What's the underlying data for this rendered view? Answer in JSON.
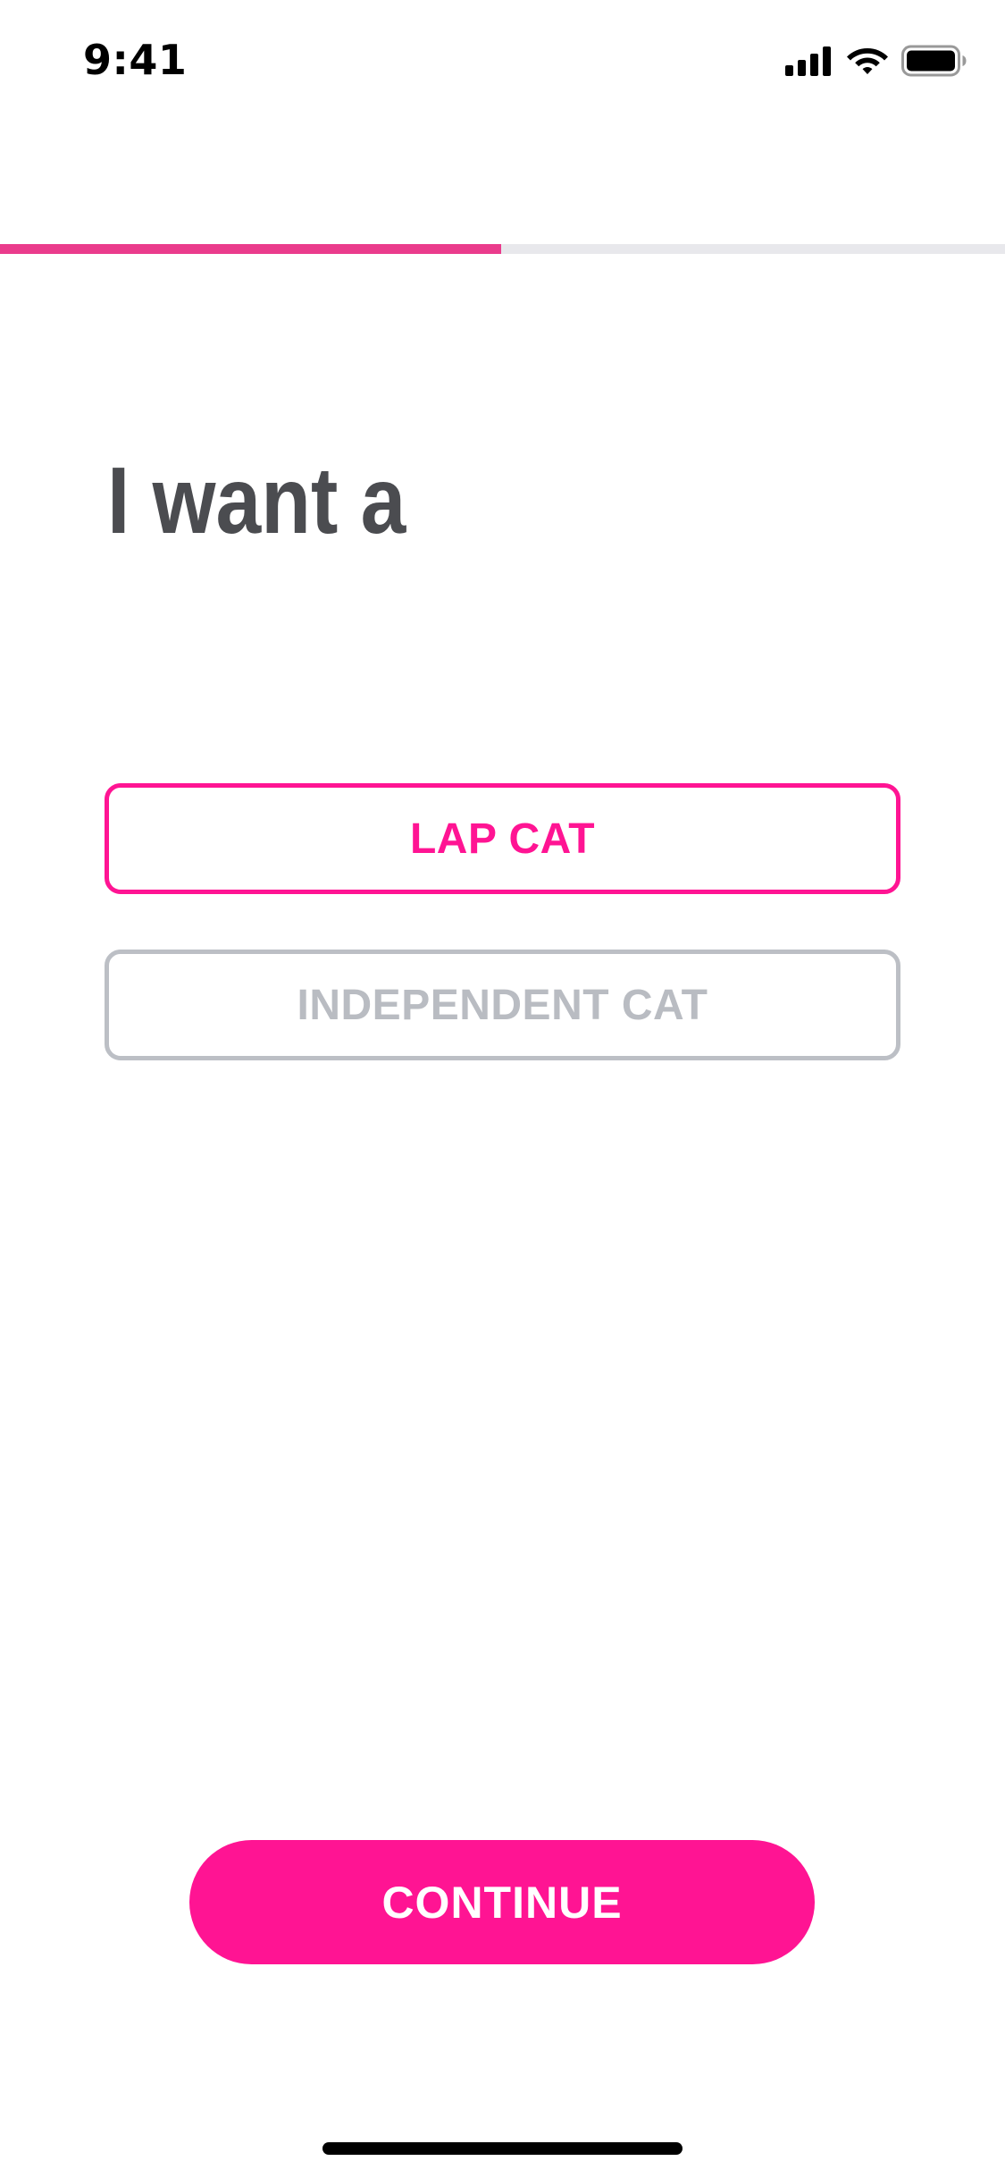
{
  "status_bar": {
    "time": "9:41",
    "icons": [
      "cellular-signal-icon",
      "wifi-icon",
      "battery-icon"
    ]
  },
  "progress": {
    "fraction": 0.5,
    "fill_color": "#ea3b8c",
    "track_color": "#e8e8ec"
  },
  "question": {
    "title": "I want a"
  },
  "options": [
    {
      "label": "LAP CAT",
      "selected": true
    },
    {
      "label": "INDEPENDENT CAT",
      "selected": false
    }
  ],
  "continue_button": {
    "label": "CONTINUE"
  },
  "colors": {
    "accent": "#ff1493",
    "title_text": "#4b4c50",
    "unselected_border": "#bcbfc5",
    "unselected_text": "#b9bcc2"
  }
}
